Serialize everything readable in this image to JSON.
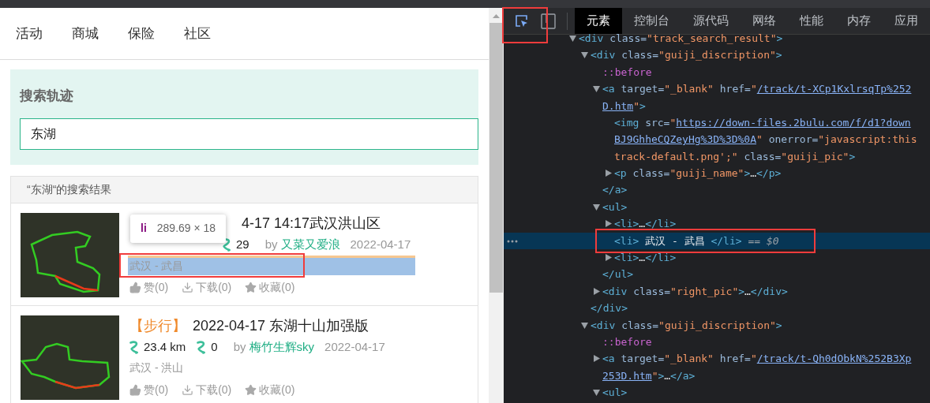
{
  "nav": [
    "活动",
    "商城",
    "保险",
    "社区"
  ],
  "search": {
    "title": "搜索轨迹",
    "value": "东湖"
  },
  "results_header": "“东湖“的搜索结果",
  "tooltip": {
    "tag": "li",
    "size": "289.69 × 18"
  },
  "results": [
    {
      "title": "4-17 14:17武汉洪山区",
      "count": "29",
      "by": "by",
      "author": "又菜又爱浪",
      "date": "2022-04-17",
      "location": "武汉 - 武昌",
      "highlighted": true,
      "actions": [
        "赞(0)",
        "下载(0)",
        "收藏(0)"
      ]
    },
    {
      "tag": "【步行】",
      "title": "2022-04-17 东湖十山加强版",
      "distance": "23.4 km",
      "count": "0",
      "by": "by",
      "author": "梅竹生辉sky",
      "date": "2022-04-17",
      "location": "武汉 - 洪山",
      "highlighted": false,
      "actions": [
        "赞(0)",
        "下载(0)",
        "收藏(0)"
      ]
    }
  ],
  "devtools": {
    "inspect_active": true,
    "tabs": [
      {
        "label": "元素",
        "selected": true
      },
      {
        "label": "控制台",
        "selected": false
      },
      {
        "label": "源代码",
        "selected": false
      },
      {
        "label": "网络",
        "selected": false
      },
      {
        "label": "性能",
        "selected": false
      },
      {
        "label": "内存",
        "selected": false
      },
      {
        "label": "应用",
        "selected": false
      }
    ],
    "tree": [
      {
        "expanded": true,
        "lines": [
          [
            {
              "kind": "tag",
              "s": "<div "
            },
            {
              "kind": "attribute",
              "s": "class="
            },
            {
              "kind": "value",
              "s": "\"track_search_result\""
            },
            {
              "kind": "tag",
              "s": ">"
            }
          ]
        ],
        "children": [
          {
            "expanded": true,
            "lines": [
              [
                {
                  "kind": "tag",
                  "s": "<div "
                },
                {
                  "kind": "attribute",
                  "s": "class="
                },
                {
                  "kind": "value",
                  "s": "\"guiji_discription\""
                },
                {
                  "kind": "tag",
                  "s": ">"
                }
              ]
            ],
            "children": [
              {
                "lines": [
                  [
                    {
                      "kind": "pseudo",
                      "s": "::before"
                    }
                  ]
                ]
              },
              {
                "expanded": true,
                "lines": [
                  [
                    {
                      "kind": "tag",
                      "s": "<a "
                    },
                    {
                      "kind": "attribute",
                      "s": "target="
                    },
                    {
                      "kind": "value",
                      "s": "\"_blank\" "
                    },
                    {
                      "kind": "attribute",
                      "s": "href="
                    },
                    {
                      "kind": "value",
                      "s": "\""
                    },
                    {
                      "kind": "link",
                      "s": "/track/t-XCp1KxlrsqTp%252"
                    }
                  ],
                  [
                    {
                      "kind": "link",
                      "s": "D.htm"
                    },
                    {
                      "kind": "value",
                      "s": "\""
                    },
                    {
                      "kind": "tag",
                      "s": ">"
                    }
                  ]
                ],
                "children": [
                  {
                    "lines": [
                      [
                        {
                          "kind": "tag",
                          "s": "<img "
                        },
                        {
                          "kind": "attribute",
                          "s": "src="
                        },
                        {
                          "kind": "value",
                          "s": "\""
                        },
                        {
                          "kind": "link",
                          "s": "https://down-files.2bulu.com/f/d1?down"
                        }
                      ],
                      [
                        {
                          "kind": "link",
                          "s": "BJ9GhheCQZeyHg%3D%3D%0A"
                        },
                        {
                          "kind": "value",
                          "s": "\" "
                        },
                        {
                          "kind": "attribute",
                          "s": "onerror="
                        },
                        {
                          "kind": "value",
                          "s": "\"javascript:this"
                        }
                      ],
                      [
                        {
                          "kind": "value",
                          "s": "track-default.png';\" "
                        },
                        {
                          "kind": "attribute",
                          "s": "class="
                        },
                        {
                          "kind": "value",
                          "s": "\"guiji_pic\""
                        },
                        {
                          "kind": "tag",
                          "s": ">"
                        }
                      ]
                    ]
                  },
                  {
                    "expanded": false,
                    "lines": [
                      [
                        {
                          "kind": "tag",
                          "s": "<p "
                        },
                        {
                          "kind": "attribute",
                          "s": "class="
                        },
                        {
                          "kind": "value",
                          "s": "\"guiji_name\""
                        },
                        {
                          "kind": "tag",
                          "s": ">"
                        },
                        {
                          "kind": "text",
                          "s": "…"
                        },
                        {
                          "kind": "tag",
                          "s": "</p>"
                        }
                      ]
                    ]
                  }
                ],
                "closing": [
                  {
                    "kind": "tag",
                    "s": "</a>"
                  }
                ]
              },
              {
                "expanded": true,
                "lines": [
                  [
                    {
                      "kind": "tag",
                      "s": "<ul>"
                    }
                  ]
                ],
                "children": [
                  {
                    "expanded": false,
                    "lines": [
                      [
                        {
                          "kind": "tag",
                          "s": "<li>"
                        },
                        {
                          "kind": "text",
                          "s": "…"
                        },
                        {
                          "kind": "tag",
                          "s": "</li>"
                        }
                      ]
                    ]
                  },
                  {
                    "selected": true,
                    "lines": [
                      [
                        {
                          "kind": "tag",
                          "s": "<li>"
                        },
                        {
                          "kind": "text",
                          "s": " 武汉 - 武昌 "
                        },
                        {
                          "kind": "tag",
                          "s": "</li>"
                        },
                        {
                          "kind": "console",
                          "s": " == $0"
                        }
                      ]
                    ]
                  },
                  {
                    "expanded": false,
                    "lines": [
                      [
                        {
                          "kind": "tag",
                          "s": "<li>"
                        },
                        {
                          "kind": "text",
                          "s": "…"
                        },
                        {
                          "kind": "tag",
                          "s": "</li>"
                        }
                      ]
                    ]
                  }
                ],
                "closing": [
                  {
                    "kind": "tag",
                    "s": "</ul>"
                  }
                ]
              },
              {
                "expanded": false,
                "lines": [
                  [
                    {
                      "kind": "tag",
                      "s": "<div "
                    },
                    {
                      "kind": "attribute",
                      "s": "class="
                    },
                    {
                      "kind": "value",
                      "s": "\"right_pic\""
                    },
                    {
                      "kind": "tag",
                      "s": ">"
                    },
                    {
                      "kind": "text",
                      "s": "…"
                    },
                    {
                      "kind": "tag",
                      "s": "</div>"
                    }
                  ]
                ]
              }
            ],
            "closing": [
              {
                "kind": "tag",
                "s": "</div>"
              }
            ]
          },
          {
            "expanded": true,
            "lines": [
              [
                {
                  "kind": "tag",
                  "s": "<div "
                },
                {
                  "kind": "attribute",
                  "s": "class="
                },
                {
                  "kind": "value",
                  "s": "\"guiji_discription\""
                },
                {
                  "kind": "tag",
                  "s": ">"
                }
              ]
            ],
            "children": [
              {
                "lines": [
                  [
                    {
                      "kind": "pseudo",
                      "s": "::before"
                    }
                  ]
                ]
              },
              {
                "expanded": false,
                "lines": [
                  [
                    {
                      "kind": "tag",
                      "s": "<a "
                    },
                    {
                      "kind": "attribute",
                      "s": "target="
                    },
                    {
                      "kind": "value",
                      "s": "\"_blank\" "
                    },
                    {
                      "kind": "attribute",
                      "s": "href="
                    },
                    {
                      "kind": "value",
                      "s": "\""
                    },
                    {
                      "kind": "link",
                      "s": "/track/t-Qh0dObkN%252B3Xp"
                    }
                  ],
                  [
                    {
                      "kind": "link",
                      "s": "253D.htm"
                    },
                    {
                      "kind": "value",
                      "s": "\""
                    },
                    {
                      "kind": "tag",
                      "s": ">"
                    },
                    {
                      "kind": "text",
                      "s": "…"
                    },
                    {
                      "kind": "tag",
                      "s": "</a>"
                    }
                  ]
                ]
              },
              {
                "expanded": true,
                "lines": [
                  [
                    {
                      "kind": "tag",
                      "s": "<ul>"
                    }
                  ]
                ]
              }
            ]
          }
        ]
      }
    ]
  }
}
